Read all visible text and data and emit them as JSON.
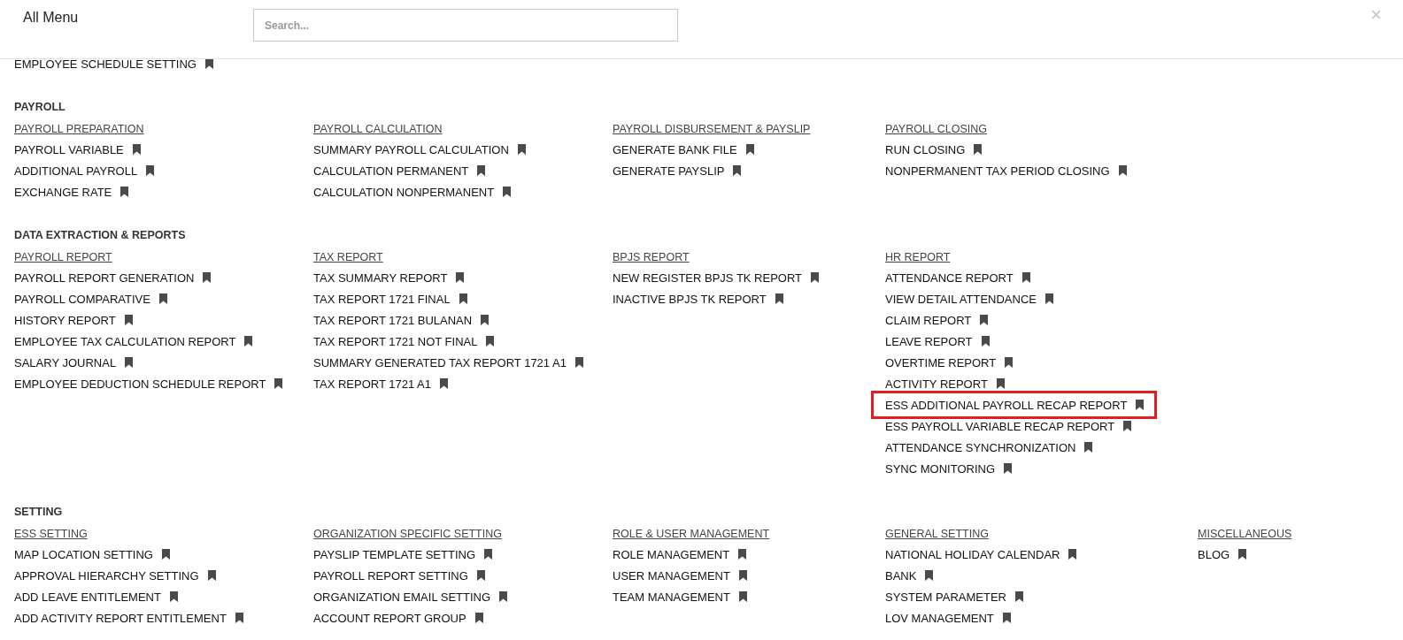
{
  "header": {
    "title": "All Menu",
    "search": {
      "placeholder": "Search..."
    },
    "close": "×"
  },
  "sections": [
    {
      "groups": [
        {
          "items": [
            {
              "label": "EMPLOYEE SCHEDULE SETTING",
              "highlighted": false
            }
          ]
        }
      ]
    },
    {
      "title": "PAYROLL",
      "groups": [
        {
          "heading": "PAYROLL PREPARATION",
          "items": [
            {
              "label": "PAYROLL VARIABLE",
              "highlighted": false
            },
            {
              "label": "ADDITIONAL PAYROLL",
              "highlighted": false
            },
            {
              "label": "EXCHANGE RATE",
              "highlighted": false
            }
          ]
        },
        {
          "heading": "PAYROLL CALCULATION",
          "items": [
            {
              "label": "SUMMARY PAYROLL CALCULATION",
              "highlighted": false
            },
            {
              "label": "CALCULATION PERMANENT",
              "highlighted": false
            },
            {
              "label": "CALCULATION NONPERMANENT",
              "highlighted": false
            }
          ]
        },
        {
          "heading": "PAYROLL DISBURSEMENT & PAYSLIP",
          "items": [
            {
              "label": "GENERATE BANK FILE",
              "highlighted": false
            },
            {
              "label": "GENERATE PAYSLIP",
              "highlighted": false
            }
          ]
        },
        {
          "heading": "PAYROLL CLOSING",
          "items": [
            {
              "label": "RUN CLOSING",
              "highlighted": false
            },
            {
              "label": "NONPERMANENT TAX PERIOD CLOSING",
              "highlighted": false
            }
          ]
        }
      ]
    },
    {
      "title": "DATA EXTRACTION & REPORTS",
      "groups": [
        {
          "heading": "PAYROLL REPORT",
          "items": [
            {
              "label": "PAYROLL REPORT GENERATION",
              "highlighted": false
            },
            {
              "label": "PAYROLL COMPARATIVE",
              "highlighted": false
            },
            {
              "label": "HISTORY REPORT",
              "highlighted": false
            },
            {
              "label": "EMPLOYEE TAX CALCULATION REPORT",
              "highlighted": false
            },
            {
              "label": "SALARY JOURNAL",
              "highlighted": false
            },
            {
              "label": "EMPLOYEE DEDUCTION SCHEDULE REPORT",
              "highlighted": false
            }
          ]
        },
        {
          "heading": "TAX REPORT",
          "items": [
            {
              "label": "TAX SUMMARY REPORT",
              "highlighted": false
            },
            {
              "label": "TAX REPORT 1721 FINAL",
              "highlighted": false
            },
            {
              "label": "TAX REPORT 1721 BULANAN",
              "highlighted": false
            },
            {
              "label": "TAX REPORT 1721 NOT FINAL",
              "highlighted": false
            },
            {
              "label": "SUMMARY GENERATED TAX REPORT 1721 A1",
              "highlighted": false
            },
            {
              "label": "TAX REPORT 1721 A1",
              "highlighted": false
            }
          ]
        },
        {
          "heading": "BPJS REPORT",
          "items": [
            {
              "label": "NEW REGISTER BPJS TK REPORT",
              "highlighted": false
            },
            {
              "label": "INACTIVE BPJS TK REPORT",
              "highlighted": false
            }
          ]
        },
        {
          "heading": "HR REPORT",
          "items": [
            {
              "label": "ATTENDANCE REPORT",
              "highlighted": false
            },
            {
              "label": "VIEW DETAIL ATTENDANCE",
              "highlighted": false
            },
            {
              "label": "CLAIM REPORT",
              "highlighted": false
            },
            {
              "label": "LEAVE REPORT",
              "highlighted": false
            },
            {
              "label": "OVERTIME REPORT",
              "highlighted": false
            },
            {
              "label": "ACTIVITY REPORT",
              "highlighted": false
            },
            {
              "label": "ESS ADDITIONAL PAYROLL RECAP REPORT",
              "highlighted": true
            },
            {
              "label": "ESS PAYROLL VARIABLE RECAP REPORT",
              "highlighted": false
            },
            {
              "label": "ATTENDANCE SYNCHRONIZATION",
              "highlighted": false
            },
            {
              "label": "SYNC MONITORING",
              "highlighted": false
            }
          ]
        }
      ]
    },
    {
      "title": "SETTING",
      "groups": [
        {
          "heading": "ESS SETTING",
          "items": [
            {
              "label": "MAP LOCATION SETTING",
              "highlighted": false
            },
            {
              "label": "APPROVAL HIERARCHY SETTING",
              "highlighted": false
            },
            {
              "label": "ADD LEAVE ENTITLEMENT",
              "highlighted": false
            },
            {
              "label": "ADD ACTIVITY REPORT ENTITLEMENT",
              "highlighted": false
            }
          ]
        },
        {
          "heading": "ORGANIZATION SPECIFIC SETTING",
          "items": [
            {
              "label": "PAYSLIP TEMPLATE SETTING",
              "highlighted": false
            },
            {
              "label": "PAYROLL REPORT SETTING",
              "highlighted": false
            },
            {
              "label": "ORGANIZATION EMAIL SETTING",
              "highlighted": false
            },
            {
              "label": "ACCOUNT REPORT GROUP",
              "highlighted": false
            }
          ]
        },
        {
          "heading": "ROLE & USER MANAGEMENT",
          "items": [
            {
              "label": "ROLE MANAGEMENT",
              "highlighted": false
            },
            {
              "label": "USER MANAGEMENT",
              "highlighted": false
            },
            {
              "label": "TEAM MANAGEMENT",
              "highlighted": false
            }
          ]
        },
        {
          "heading": "GENERAL SETTING",
          "items": [
            {
              "label": "NATIONAL HOLIDAY CALENDAR",
              "highlighted": false
            },
            {
              "label": "BANK",
              "highlighted": false
            },
            {
              "label": "SYSTEM PARAMETER",
              "highlighted": false
            },
            {
              "label": "LOV MANAGEMENT",
              "highlighted": false
            }
          ]
        },
        {
          "heading": "MISCELLANEOUS",
          "items": [
            {
              "label": "BLOG",
              "highlighted": false
            }
          ]
        }
      ]
    }
  ]
}
